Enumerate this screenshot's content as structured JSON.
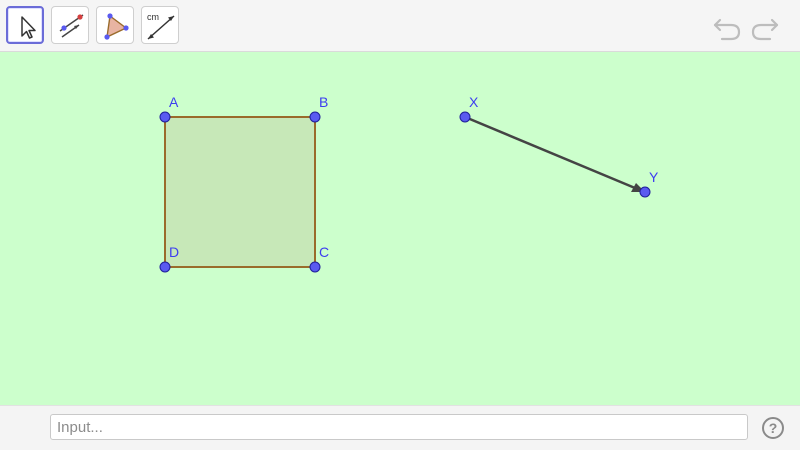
{
  "toolbar": {
    "tools": [
      {
        "icon": "move-arrow-icon",
        "active": true
      },
      {
        "icon": "line-through-points-icon",
        "active": false
      },
      {
        "icon": "polygon-icon",
        "active": false
      },
      {
        "icon": "distance-length-icon",
        "label": "cm",
        "active": false
      }
    ],
    "undo_icon": "undo-icon",
    "redo_icon": "redo-icon"
  },
  "canvas": {
    "background": "#ccffcc",
    "polygon": {
      "vertices": [
        "A",
        "B",
        "C",
        "D"
      ],
      "fill": "#c7e8b8",
      "stroke": "#9a6b2b"
    },
    "vector": {
      "start": "X",
      "end": "Y",
      "stroke": "#444444"
    },
    "point_color": "#5a5af0",
    "labels": {
      "A": "A",
      "B": "B",
      "C": "C",
      "D": "D",
      "X": "X",
      "Y": "Y"
    }
  },
  "input_bar": {
    "placeholder": "Input...",
    "help_label": "?"
  }
}
